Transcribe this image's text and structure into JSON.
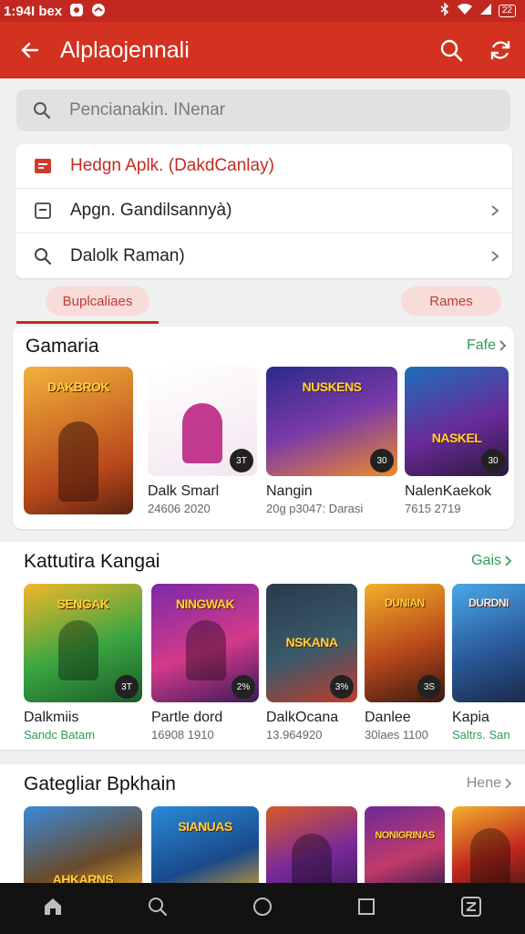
{
  "status": {
    "time": "1:94I bex",
    "battery": "22"
  },
  "appbar": {
    "title": "Alplaojennali"
  },
  "search": {
    "placeholder": "Pencianakin. INenar"
  },
  "menu": [
    {
      "label": "Hedgn Aplk. (DakdCanlay)",
      "icon": "app-icon"
    },
    {
      "label": "Apgn. Gandilsannyà)",
      "icon": "square-icon"
    },
    {
      "label": "Dalolk Raman)",
      "icon": "search-icon"
    }
  ],
  "tabs": {
    "left": "Buplcaliaes",
    "right": "Rames"
  },
  "sections": [
    {
      "title": "Gamaria",
      "more": "Fafe",
      "cards": [
        {
          "name": "",
          "sub": "",
          "art": "DAKBROK",
          "badge": ""
        },
        {
          "name": "Dalk Smarl",
          "sub": "24606 2020",
          "art": "",
          "badge": "3T"
        },
        {
          "name": "Nangin",
          "sub": "20g p3047: Darasi",
          "art": "NUSKENS",
          "badge": "30"
        },
        {
          "name": "NalenKaekok",
          "sub": "7615 2719",
          "art": "NASKEL",
          "badge": "30"
        }
      ]
    },
    {
      "title": "Kattutira Kangai",
      "more": "Gais",
      "cards": [
        {
          "name": "Dalkmiis",
          "sub": "Sandc Batam",
          "art": "SENGAK",
          "badge": "3T"
        },
        {
          "name": "Partle dord",
          "sub": "16908 1910",
          "art": "NINGWAK",
          "badge": "2%"
        },
        {
          "name": "DalkOcana",
          "sub": "13.964920",
          "art": "NSKANA",
          "badge": "3%"
        },
        {
          "name": "Danlee",
          "sub": "30laes 1100",
          "art": "DUNIAN",
          "badge": "3S"
        },
        {
          "name": "Kapia",
          "sub": "Saltrs. San",
          "art": "DURDNI",
          "badge": ""
        }
      ]
    },
    {
      "title": "Gategliar Bpkhain",
      "more": "Hene",
      "cards": [
        {
          "art": "AHKARNS"
        },
        {
          "art": "SIANUAS"
        },
        {
          "art": ""
        },
        {
          "art": "NONIGRINAS"
        },
        {
          "art": ""
        }
      ]
    }
  ],
  "colors": {
    "accent": "#d2321f",
    "link_green": "#2a9d55"
  }
}
